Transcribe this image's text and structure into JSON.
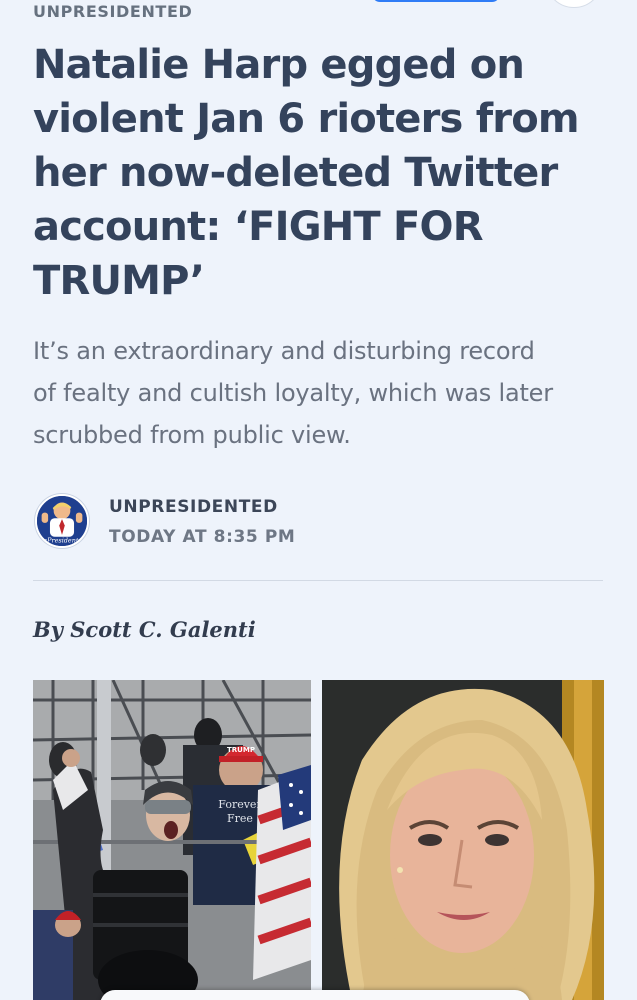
{
  "header": {
    "publication_label": "UNPRESIDENTED"
  },
  "article": {
    "headline_lines": [
      "Natalie Harp egged on",
      "violent Jan 6 rioters from",
      "her now-deleted Twitter",
      "account: ‘FIGHT FOR",
      "TRUMP’"
    ],
    "dek_lines": [
      "It’s an extraordinary and disturbing record",
      "of fealty and cultish loyalty, which was later",
      "scrubbed from public view."
    ],
    "source": {
      "name": "UNPRESIDENTED",
      "timestamp": "TODAY AT 8:35 PM",
      "avatar_text": "UnPresidented"
    },
    "author": "By Scott C. Galenti",
    "photo_left": {
      "hat_text": "TRUMP",
      "sign_lines": [
        "Forever",
        "Free"
      ]
    }
  },
  "colors": {
    "background": "#eef3fb",
    "headline": "#34435c",
    "dek": "#6a7280",
    "accent_blue": "#2f7cf6"
  }
}
